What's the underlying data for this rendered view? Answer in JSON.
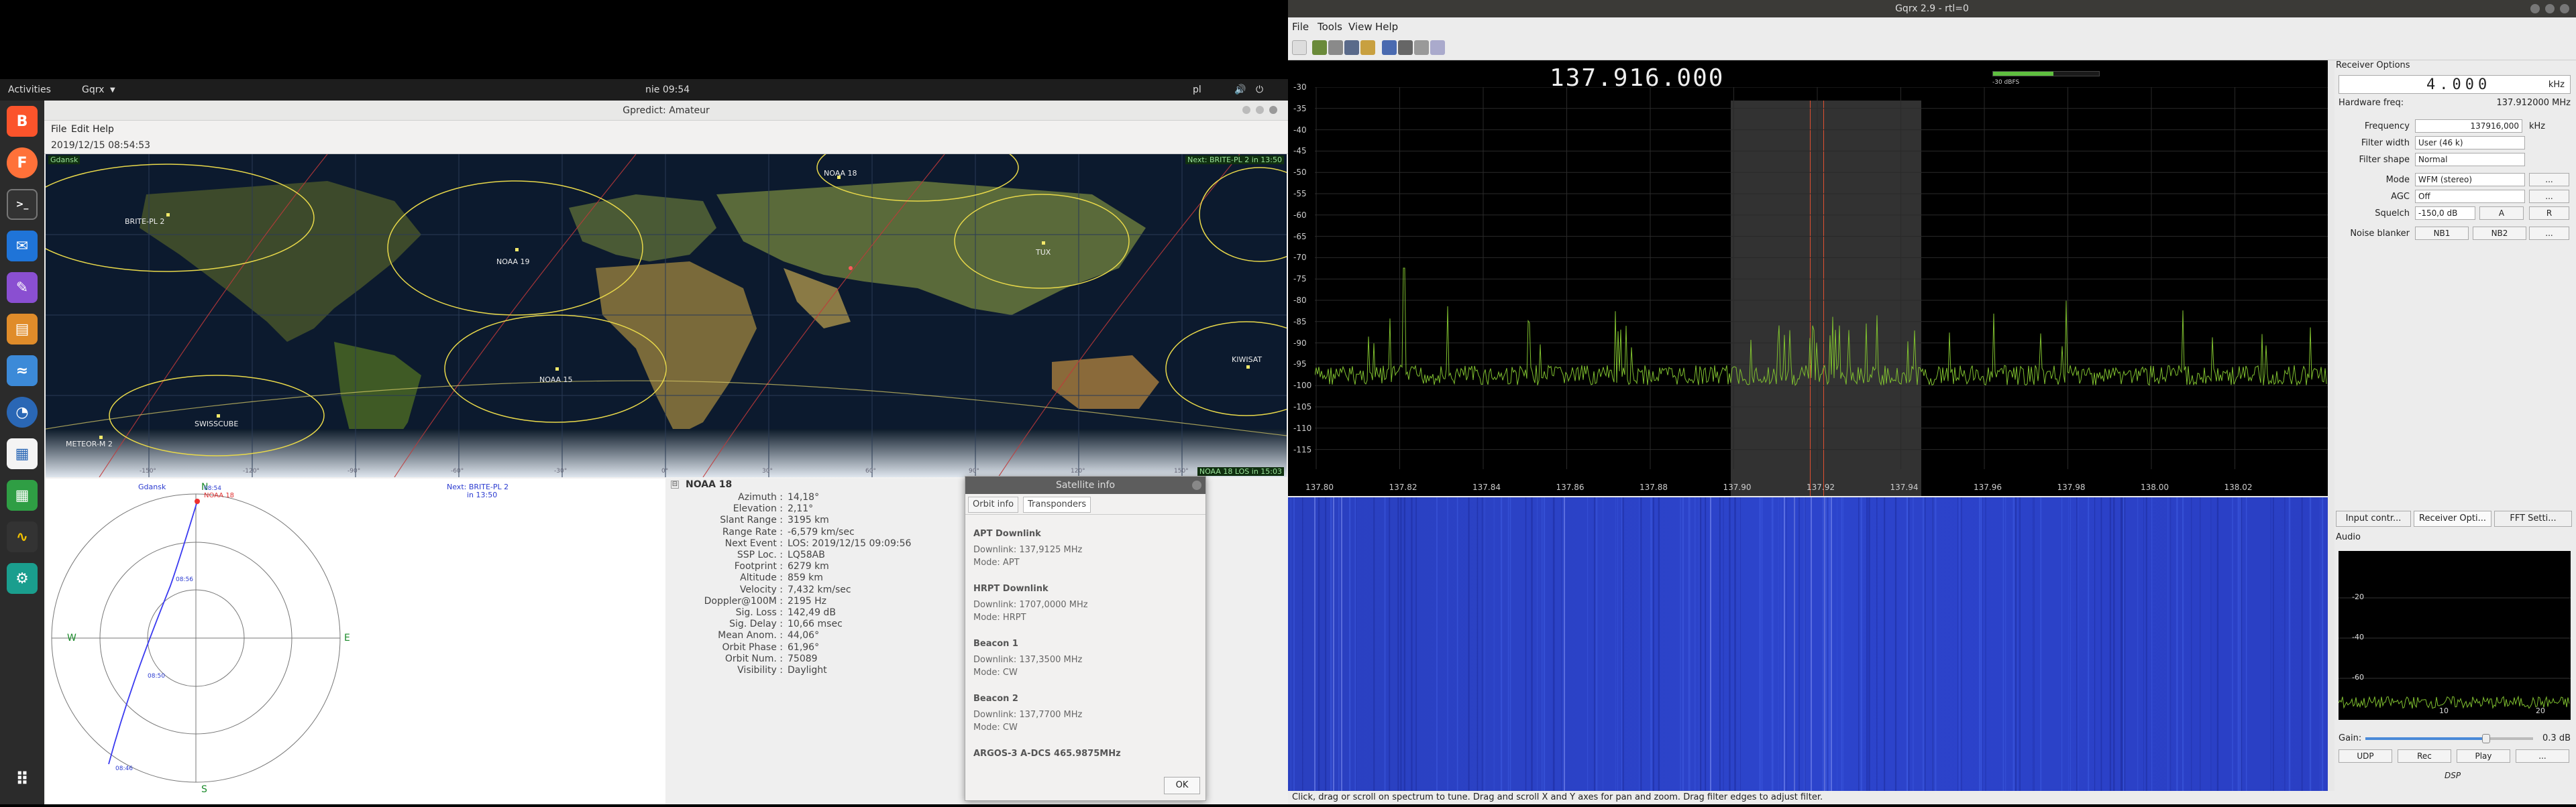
{
  "left": {
    "topbar": {
      "activities": "Activities",
      "app": "Gqrx",
      "clock": "nie 09:54",
      "lang": "pl"
    },
    "gpredict": {
      "title": "Gpredict: Amateur",
      "menu": [
        "File",
        "Edit",
        "Help"
      ],
      "time": "2019/12/15 08:54:53",
      "map": {
        "corner_left": "Gdansk",
        "corner_right": "Next: BRITE-PL 2 in 13:50",
        "bottom_right": "NOAA 18 LOS in 15:03",
        "sats": [
          "BRITE-PL 2",
          "NOAA 19",
          "NOAA 18",
          "NOAA 15",
          "SWISSCUBE",
          "METEOR-M 2",
          "KIWISAT",
          "TUX"
        ],
        "lon_ticks": [
          "-150°",
          "-120°",
          "-90°",
          "-60°",
          "-30°",
          "0°",
          "30°",
          "60°",
          "90°",
          "120°",
          "150°"
        ]
      },
      "polar": {
        "station": "Gdansk",
        "next": "Next: BRITE-PL 2",
        "next_in": "in 13:50",
        "north": "N",
        "south": "S",
        "east": "E",
        "west": "W",
        "sat": "NOAA 18",
        "times": [
          "08:54",
          "08:56",
          "08:50",
          "08:46"
        ]
      },
      "sat_details": {
        "name": "NOAA 18",
        "rows": [
          {
            "k": "Azimuth :",
            "v": "14,18°"
          },
          {
            "k": "Elevation :",
            "v": "2,11°"
          },
          {
            "k": "Slant Range :",
            "v": "3195 km"
          },
          {
            "k": "Range Rate :",
            "v": "-6,579 km/sec"
          },
          {
            "k": "Next Event :",
            "v": "LOS: 2019/12/15 09:09:56"
          },
          {
            "k": "SSP Loc. :",
            "v": "LQ58AB"
          },
          {
            "k": "Footprint :",
            "v": "6279 km"
          },
          {
            "k": "Altitude :",
            "v": "859 km"
          },
          {
            "k": "Velocity :",
            "v": "7,432 km/sec"
          },
          {
            "k": "Doppler@100M :",
            "v": "2195 Hz"
          },
          {
            "k": "Sig. Loss :",
            "v": "142,49 dB"
          },
          {
            "k": "Sig. Delay :",
            "v": "10,66 msec"
          },
          {
            "k": "Mean Anom. :",
            "v": "44,06°"
          },
          {
            "k": "Orbit Phase :",
            "v": "61,96°"
          },
          {
            "k": "Orbit Num. :",
            "v": "75089"
          },
          {
            "k": "Visibility :",
            "v": "Daylight"
          }
        ]
      },
      "satinfo_dialog": {
        "title": "Satellite info",
        "tabs": [
          "Orbit info",
          "Transponders"
        ],
        "sections": [
          {
            "title": "APT Downlink",
            "lines": [
              "Downlink: 137,9125 MHz",
              "Mode: APT"
            ]
          },
          {
            "title": "HRPT Downlink",
            "lines": [
              "Downlink: 1707,0000 MHz",
              "Mode: HRPT"
            ]
          },
          {
            "title": "Beacon 1",
            "lines": [
              "Downlink: 137,3500 MHz",
              "Mode: CW"
            ]
          },
          {
            "title": "Beacon 2",
            "lines": [
              "Downlink: 137,7700 MHz",
              "Mode: CW"
            ]
          },
          {
            "title": "ARGOS-3 A-DCS 465.9875MHz",
            "lines": []
          }
        ],
        "ok": "OK"
      }
    }
  },
  "right": {
    "title": "Gqrx 2.9 - rtl=0",
    "menu": [
      "File",
      "Tools",
      "View",
      "Help"
    ],
    "frequency_display": "137.916.000",
    "dbfs_label": "-30 dBFS",
    "spectrum": {
      "y_ticks": [
        "-30",
        "-35",
        "-40",
        "-45",
        "-50",
        "-55",
        "-60",
        "-65",
        "-70",
        "-75",
        "-80",
        "-85",
        "-90",
        "-95",
        "-100",
        "-105",
        "-110",
        "-115"
      ],
      "x_ticks": [
        "137.80",
        "137.82",
        "137.84",
        "137.86",
        "137.88",
        "137.90",
        "137.92",
        "137.94",
        "137.96",
        "137.98",
        "138.00",
        "138.02"
      ]
    },
    "status": "Click, drag or scroll on spectrum to tune. Drag and scroll X and Y axes for pan and zoom. Drag filter edges to adjust filter.",
    "receiver": {
      "panel_title": "Receiver Options",
      "offset": "4.000",
      "offset_unit": "kHz",
      "hw_label": "Hardware freq:",
      "hw_value": "137.912000 MHz",
      "rows": [
        {
          "label": "Frequency",
          "value": "137916,000",
          "unit": "kHz"
        },
        {
          "label": "Filter width",
          "value": "User (46 k)"
        },
        {
          "label": "Filter shape",
          "value": "Normal"
        },
        {
          "label": "Mode",
          "value": "WFM (stereo)",
          "extra": "..."
        },
        {
          "label": "AGC",
          "value": "Off",
          "extra": "..."
        },
        {
          "label": "Squelch",
          "value": "-150,0 dB",
          "b1": "A",
          "b2": "R"
        },
        {
          "label": "Noise blanker",
          "b1": "NB1",
          "b2": "NB2",
          "extra": "..."
        }
      ],
      "tabs": [
        "Input contr...",
        "Receiver Opti...",
        "FFT Setti..."
      ]
    },
    "audio": {
      "title": "Audio",
      "y_ticks": [
        "-20",
        "-40",
        "-60"
      ],
      "x_ticks": [
        "10",
        "20"
      ],
      "gain_label": "Gain:",
      "gain_value": "0.3 dB",
      "gain_level": 0.72,
      "buttons": [
        "UDP",
        "Rec",
        "Play",
        "..."
      ],
      "dsp": "DSP"
    }
  }
}
